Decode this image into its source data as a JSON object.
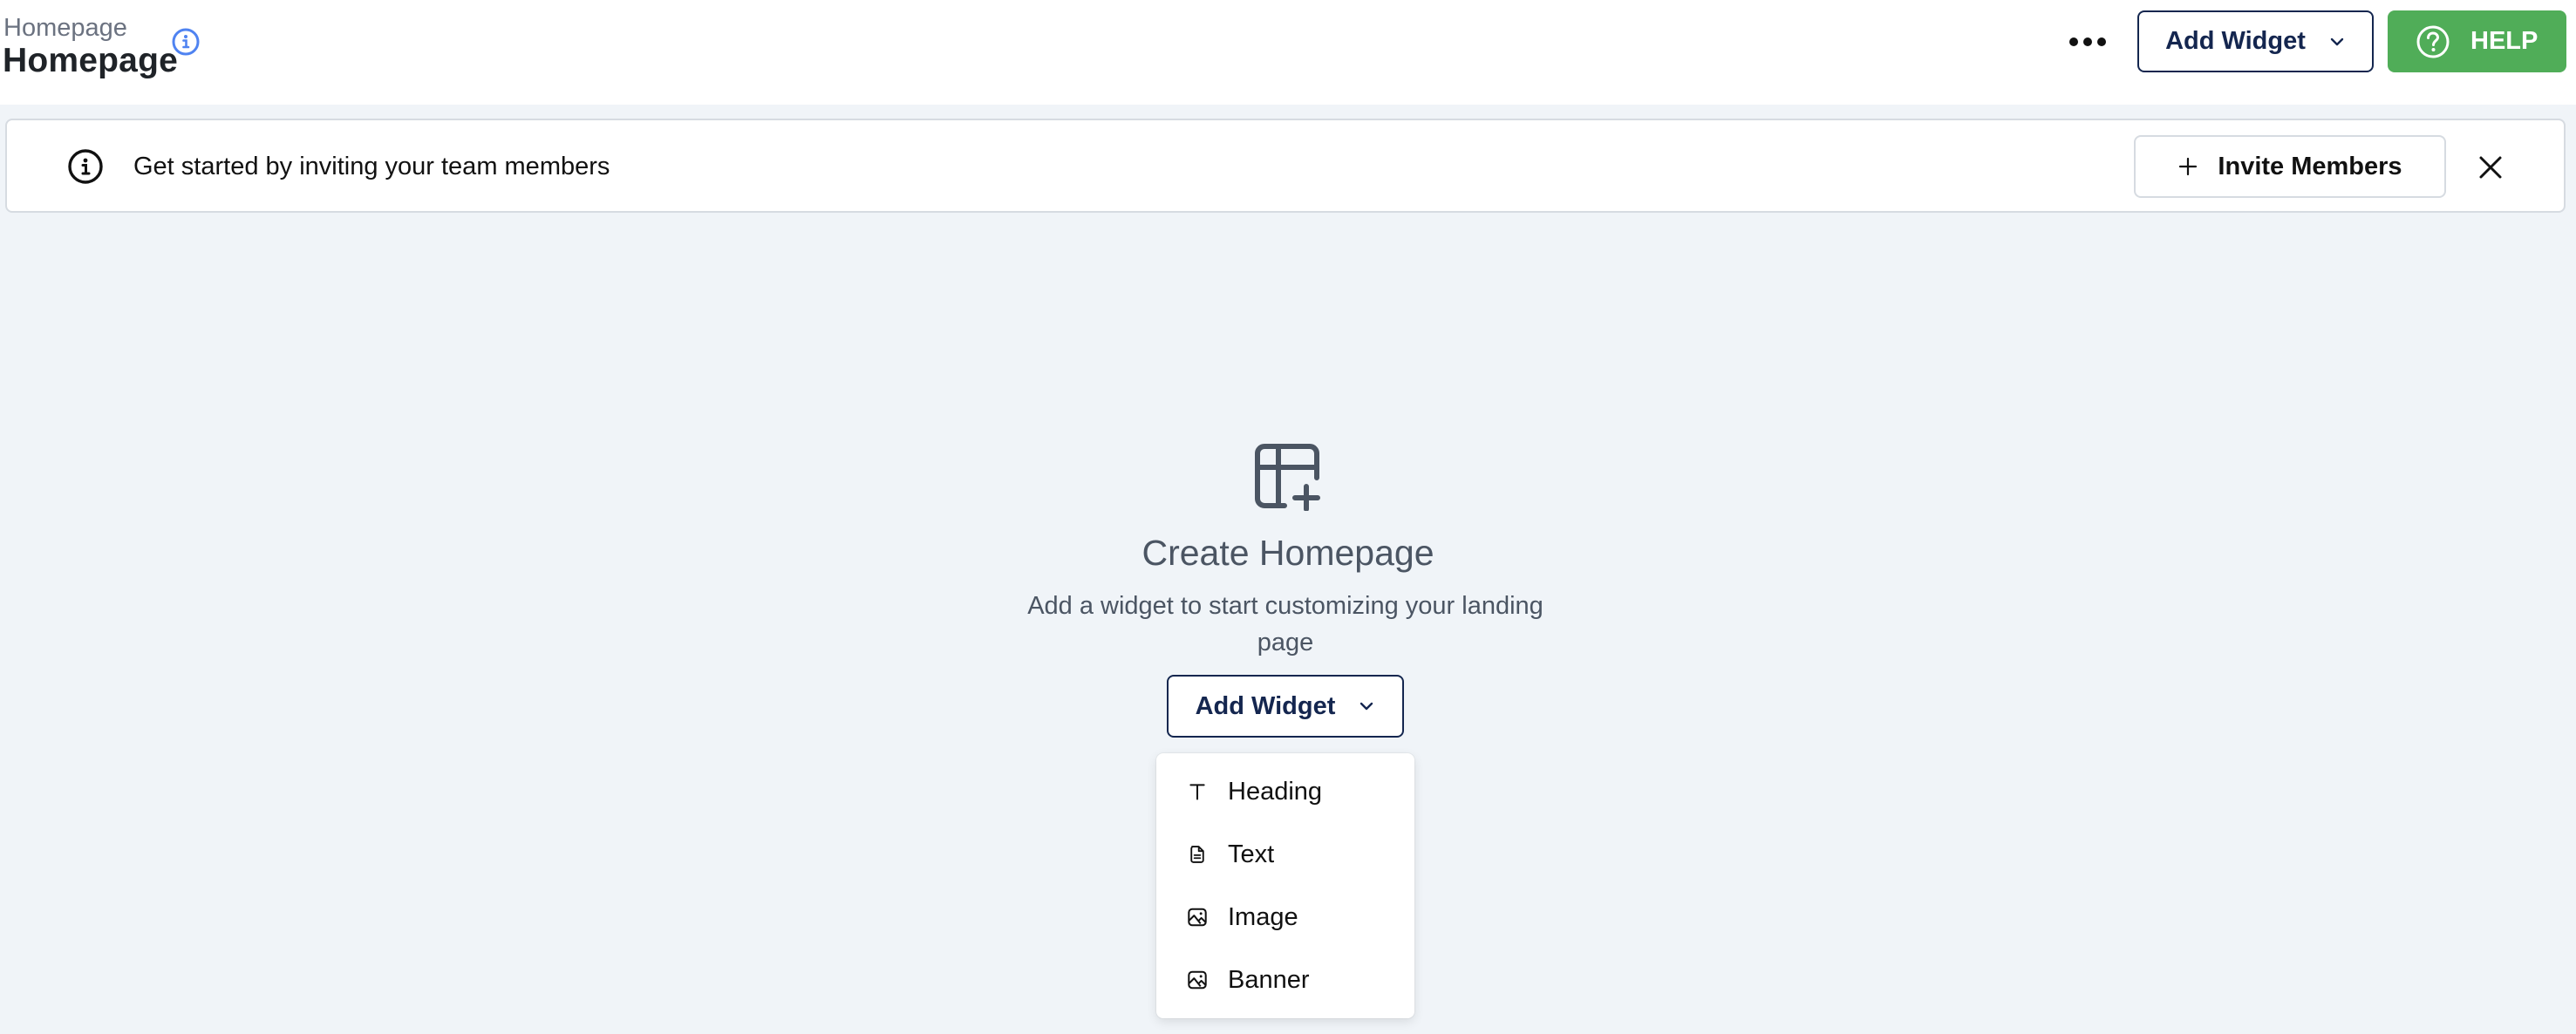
{
  "header": {
    "breadcrumb": "Homepage",
    "title": "Homepage",
    "more_label": "More options",
    "add_widget_label": "Add Widget",
    "help_label": "HELP"
  },
  "banner": {
    "message": "Get started by inviting your team members",
    "invite_label": "Invite Members"
  },
  "empty_state": {
    "title": "Create Homepage",
    "subtitle": "Add a widget to start customizing your landing page",
    "add_widget_label": "Add Widget"
  },
  "dropdown": {
    "items": [
      {
        "label": "Heading",
        "icon": "heading-icon"
      },
      {
        "label": "Text",
        "icon": "document-icon"
      },
      {
        "label": "Image",
        "icon": "image-icon"
      },
      {
        "label": "Banner",
        "icon": "image-icon"
      }
    ]
  },
  "colors": {
    "primary_navy": "#14264f",
    "help_green": "#50ad58",
    "info_blue": "#4f83f1",
    "page_bg": "#f0f4f8"
  }
}
